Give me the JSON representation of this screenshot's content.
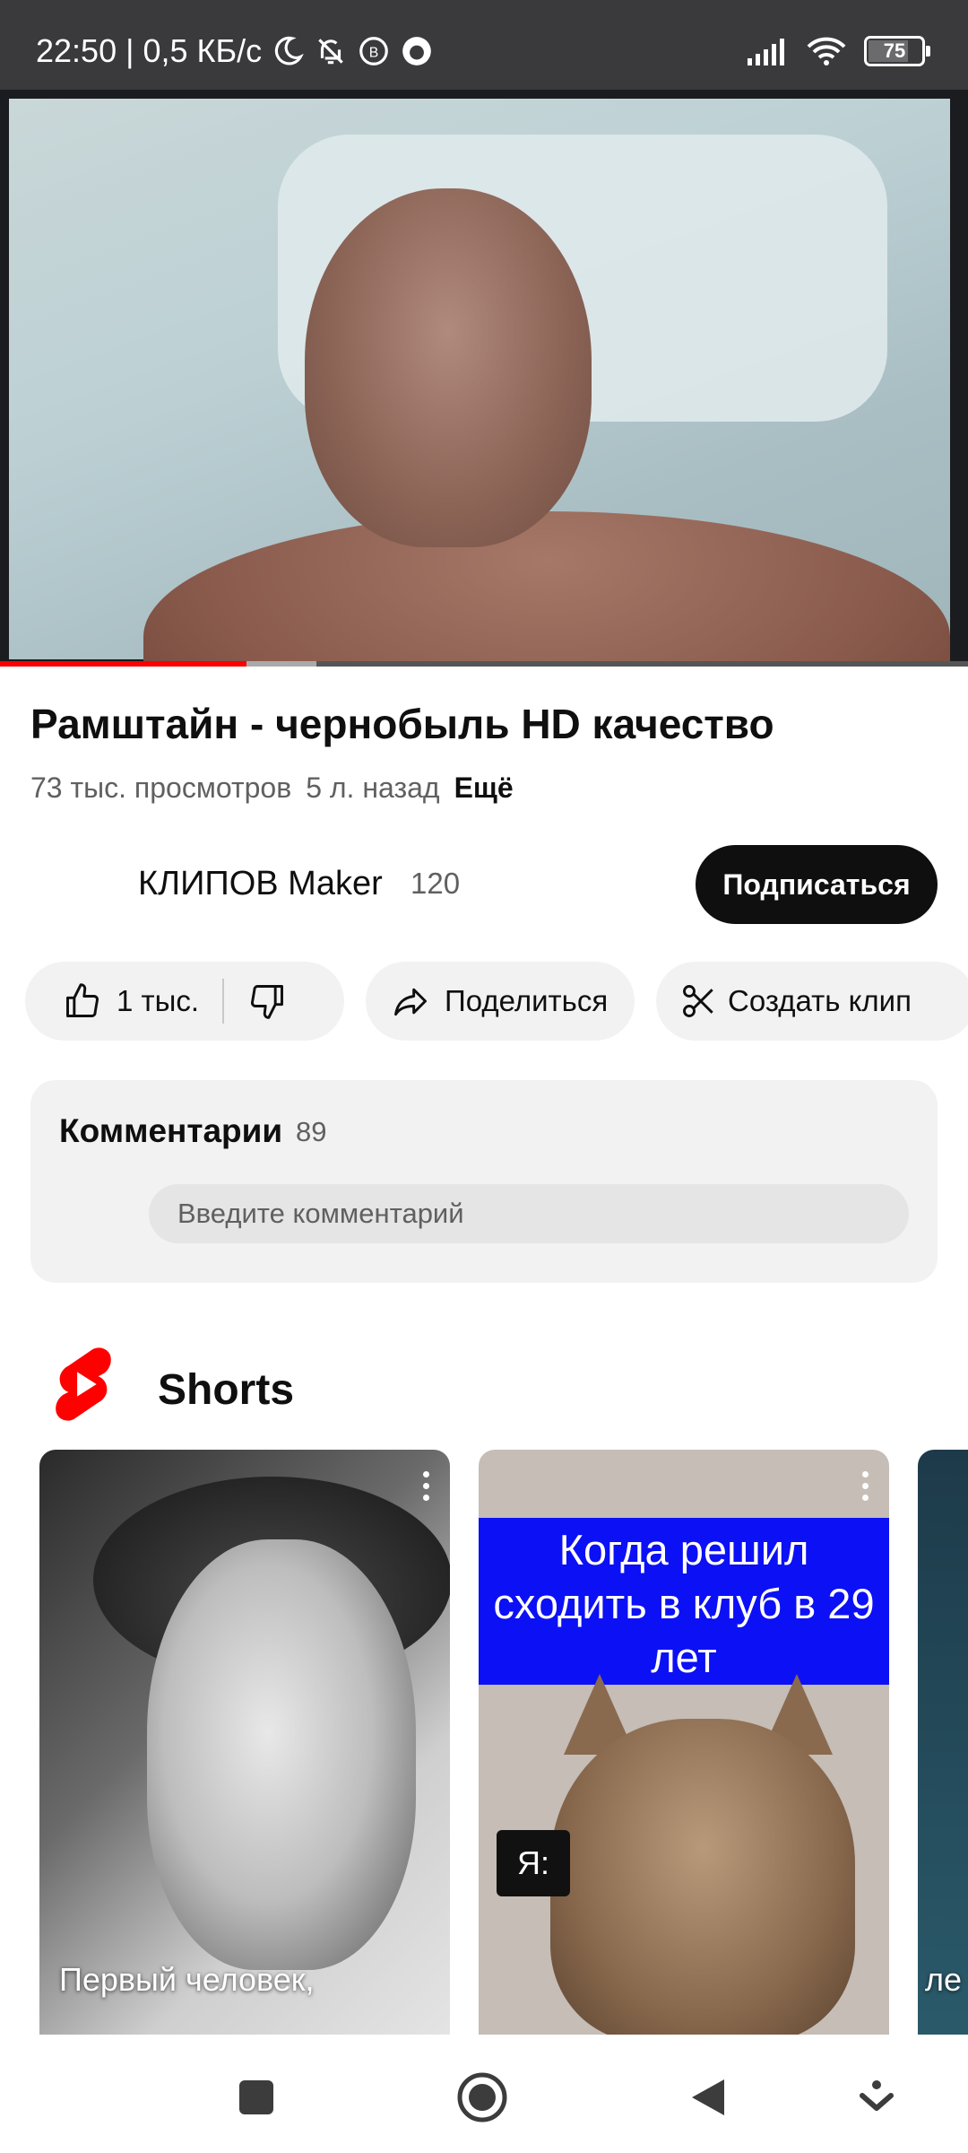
{
  "status_bar": {
    "time": "22:50",
    "separator": "|",
    "speed": "0,5 КБ/с",
    "battery": "75",
    "battery_level": 0.75,
    "icons": [
      "moon-icon",
      "bell-off-icon",
      "vk-icon",
      "firefox-icon",
      "signal-icon",
      "wifi-icon",
      "battery-icon"
    ]
  },
  "video": {
    "progress_played": 0.255,
    "progress_buffered": 0.327
  },
  "title": "Рамштайн - чернобыль HD качество",
  "meta": {
    "views": "73 тыс. просмотров",
    "age": "5 л. назад",
    "more": "Ещё"
  },
  "channel": {
    "name": "КЛИПОВ Maker",
    "subscribers": "120",
    "subscribe_label": "Подписаться"
  },
  "actions": {
    "likes": "1 тыс.",
    "share": "Поделиться",
    "clip": "Создать клип"
  },
  "comments": {
    "title": "Комментарии",
    "count": "89",
    "placeholder": "Введите комментарий"
  },
  "shorts": {
    "title": "Shorts",
    "items": [
      {
        "caption": "Первый человек,"
      },
      {
        "banner": "Когда решил сходить в клуб в 29 лет",
        "label": "Я:"
      },
      {
        "caption": "ле"
      }
    ]
  },
  "colors": {
    "accent": "#ff0000",
    "status_bar": "#3a393b",
    "subscribe_bg": "#0f0f0f",
    "pill_bg": "#f2f2f2",
    "shorts_banner": "#0c10f5"
  }
}
